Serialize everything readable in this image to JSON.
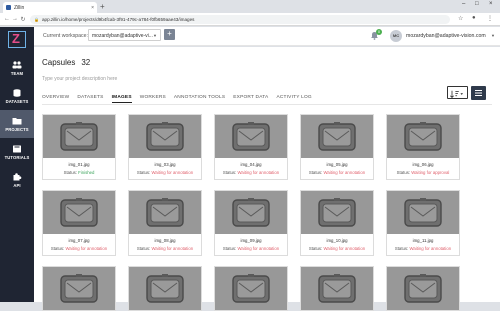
{
  "browser": {
    "tab_title": "Zillin",
    "tab_close": "×",
    "new_tab": "+",
    "url": "app.zillin.io/home/projects/d9b4fcab-3f91-479c-a784-f0fb659aae43/images",
    "window_controls": [
      "–",
      "□",
      "×"
    ]
  },
  "sidebar": {
    "items": [
      {
        "label": "TEAM",
        "icon": "team-icon"
      },
      {
        "label": "DATASETS",
        "icon": "database-icon"
      },
      {
        "label": "PROJECTS",
        "icon": "folder-icon",
        "active": true
      },
      {
        "label": "TUTORIALS",
        "icon": "book-icon"
      },
      {
        "label": "API",
        "icon": "puzzle-icon"
      }
    ]
  },
  "topbar": {
    "workspace_label": "Current workspace:",
    "workspace_value": "mozardyban@adaptive-vi...",
    "add_label": "+",
    "notif_count": "0",
    "avatar_initials": "MC",
    "user_email": "mozardyban@adaptive-vision.com"
  },
  "project": {
    "title": "Capsules",
    "count": "32",
    "description_placeholder": "Type your project description here",
    "tabs": [
      "OVERVIEW",
      "DATASETS",
      "IMAGES",
      "WORKERS",
      "ANNOTATION TOOLS",
      "EXPORT DATA",
      "ACTIVITY LOG"
    ],
    "active_tab": "IMAGES"
  },
  "status_prefix": "Status:",
  "images": [
    {
      "name": "img_01.jpg",
      "status": "Finished"
    },
    {
      "name": "img_03.jpg",
      "status": "Waiting for annotation"
    },
    {
      "name": "img_04.jpg",
      "status": "Waiting for annotation"
    },
    {
      "name": "img_05.jpg",
      "status": "Waiting for annotation"
    },
    {
      "name": "img_06.jpg",
      "status": "Waiting for approval"
    },
    {
      "name": "img_07.jpg",
      "status": "Waiting for annotation"
    },
    {
      "name": "img_08.jpg",
      "status": "Waiting for annotation"
    },
    {
      "name": "img_09.jpg",
      "status": "Waiting for annotation"
    },
    {
      "name": "img_10.jpg",
      "status": "Waiting for annotation"
    },
    {
      "name": "img_11.jpg",
      "status": "Waiting for annotation"
    },
    {
      "name": "",
      "status": ""
    },
    {
      "name": "",
      "status": ""
    },
    {
      "name": "",
      "status": ""
    },
    {
      "name": "",
      "status": ""
    },
    {
      "name": "",
      "status": ""
    }
  ],
  "colors": {
    "sidebar_bg": "#1f2533",
    "sidebar_active": "#50596b",
    "status_waiting": "#e0606c",
    "status_finished": "#3aa35a",
    "notif_badge": "#4caf50"
  }
}
